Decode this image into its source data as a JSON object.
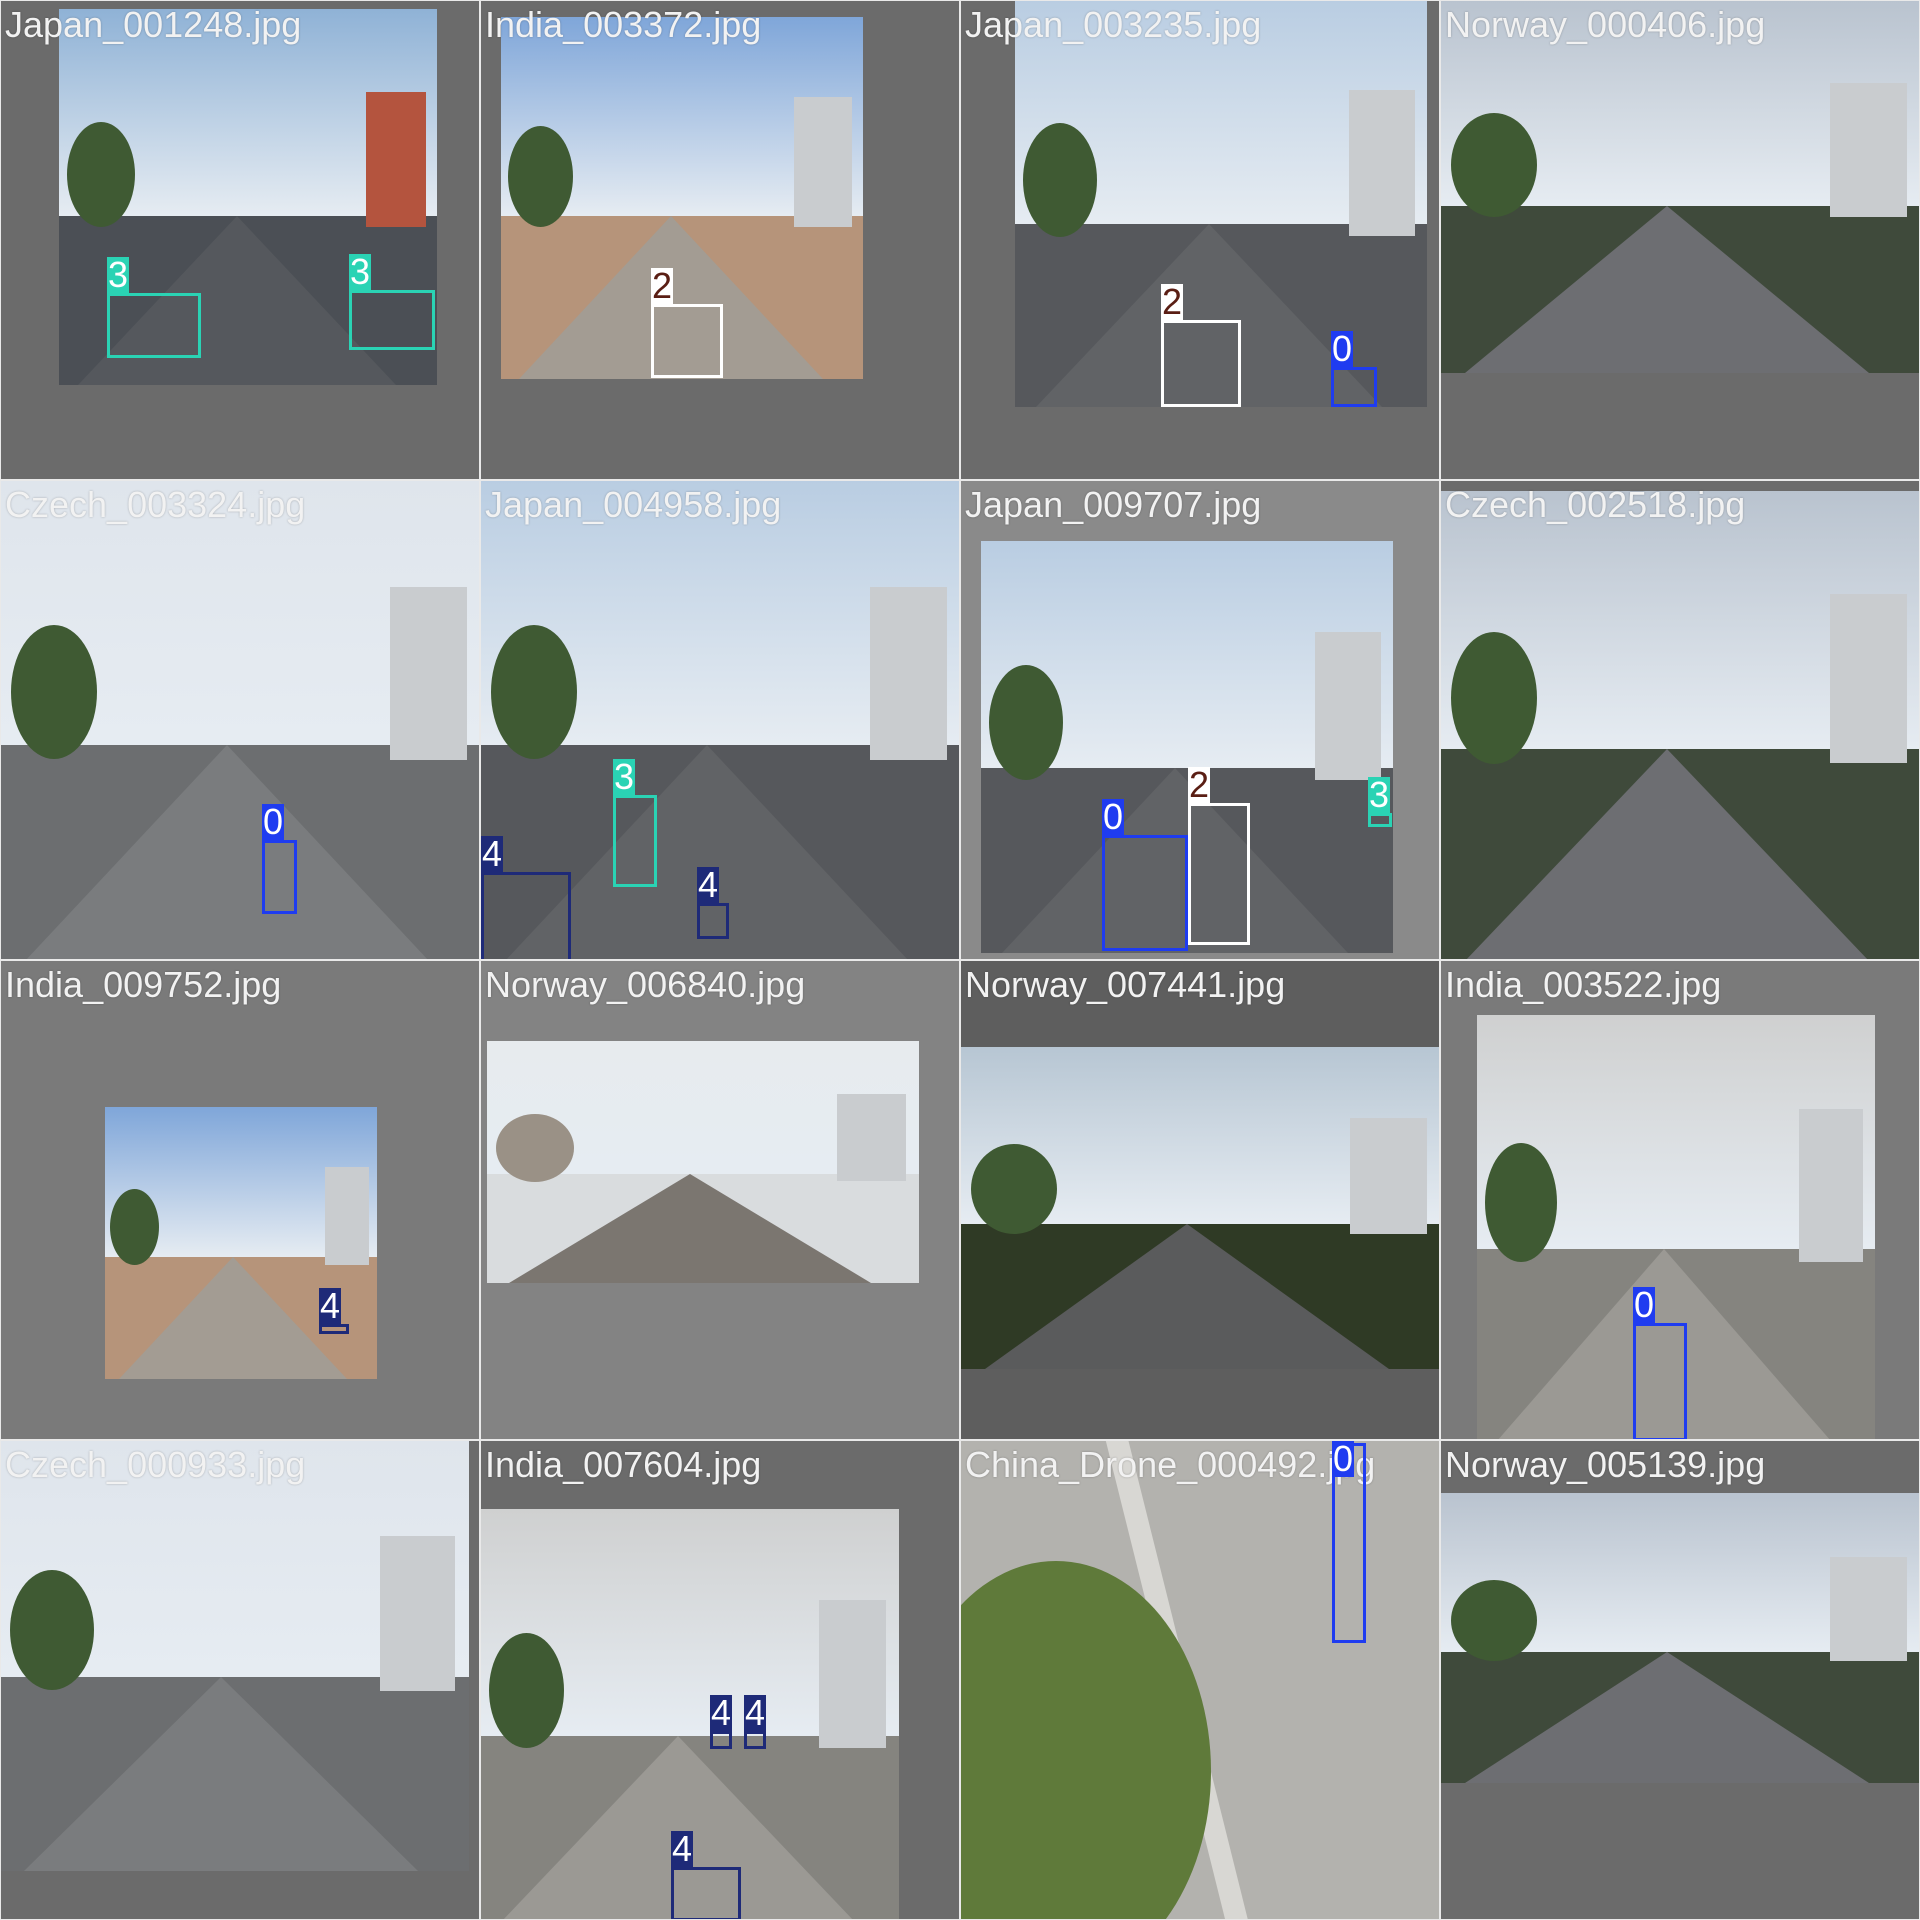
{
  "palette": {
    "0": "#1f3cf0",
    "2": "#ffffff",
    "3": "#2ad3b4",
    "4": "#1e2a78"
  },
  "label_text_color": {
    "0": "#ffffff",
    "2": "#5a1e14",
    "3": "#ffffff",
    "4": "#ffffff"
  },
  "tiles": [
    {
      "filename": "Japan_001248.jpg",
      "scene": "city",
      "detections": [
        {
          "cls": "3"
        },
        {
          "cls": "3"
        }
      ]
    },
    {
      "filename": "India_003372.jpg",
      "scene": "dusty",
      "detections": [
        {
          "cls": "2"
        }
      ]
    },
    {
      "filename": "Japan_003235.jpg",
      "scene": "suburb",
      "detections": [
        {
          "cls": "2"
        },
        {
          "cls": "0"
        }
      ]
    },
    {
      "filename": "Norway_000406.jpg",
      "scene": "rural",
      "detections": []
    },
    {
      "filename": "Czech_003324.jpg",
      "scene": "urban",
      "detections": [
        {
          "cls": "0"
        }
      ]
    },
    {
      "filename": "Japan_004958.jpg",
      "scene": "suburb",
      "detections": [
        {
          "cls": "3"
        },
        {
          "cls": "4"
        },
        {
          "cls": "4"
        }
      ]
    },
    {
      "filename": "Japan_009707.jpg",
      "scene": "suburb",
      "detections": [
        {
          "cls": "0"
        },
        {
          "cls": "2"
        },
        {
          "cls": "3"
        }
      ]
    },
    {
      "filename": "Czech_002518.jpg",
      "scene": "rural",
      "detections": []
    },
    {
      "filename": "India_009752.jpg",
      "scene": "dusty",
      "detections": [
        {
          "cls": "4"
        }
      ]
    },
    {
      "filename": "Norway_006840.jpg",
      "scene": "snow",
      "detections": []
    },
    {
      "filename": "Norway_007441.jpg",
      "scene": "forest",
      "detections": []
    },
    {
      "filename": "India_003522.jpg",
      "scene": "haze",
      "detections": [
        {
          "cls": "0"
        }
      ]
    },
    {
      "filename": "Czech_000933.jpg",
      "scene": "urban",
      "detections": []
    },
    {
      "filename": "India_007604.jpg",
      "scene": "haze",
      "detections": [
        {
          "cls": "4"
        },
        {
          "cls": "4"
        },
        {
          "cls": "4"
        }
      ]
    },
    {
      "filename": "China_Drone_000492.jpg",
      "scene": "drone",
      "detections": [
        {
          "cls": "0"
        }
      ]
    },
    {
      "filename": "Norway_005139.jpg",
      "scene": "rural",
      "detections": []
    }
  ]
}
